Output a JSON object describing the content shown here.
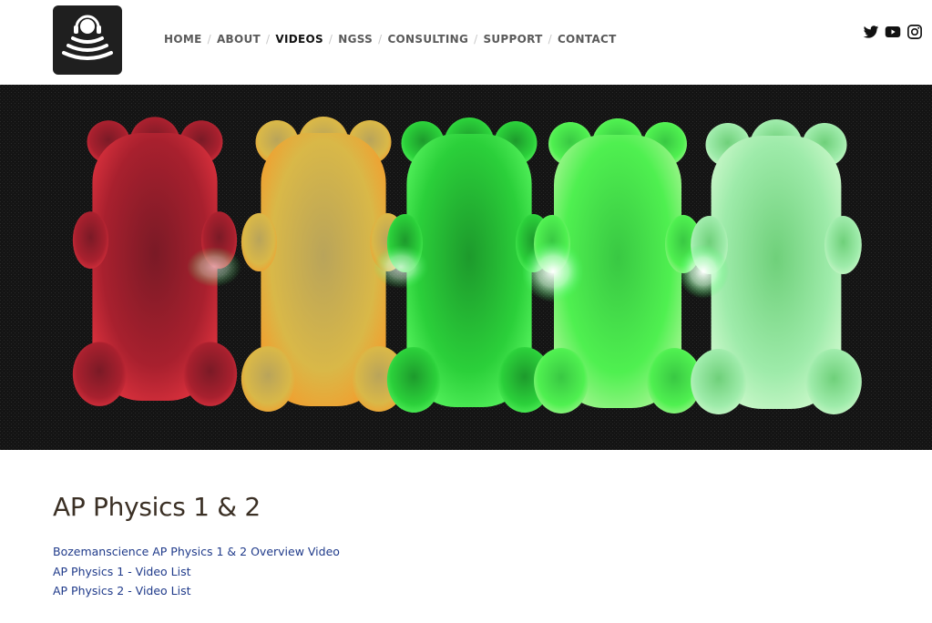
{
  "nav": {
    "items": [
      {
        "label": "HOME",
        "active": false
      },
      {
        "label": "ABOUT",
        "active": false
      },
      {
        "label": "VIDEOS",
        "active": true
      },
      {
        "label": "NGSS",
        "active": false
      },
      {
        "label": "CONSULTING",
        "active": false
      },
      {
        "label": "SUPPORT",
        "active": false
      },
      {
        "label": "CONTACT",
        "active": false
      }
    ],
    "separator": "/"
  },
  "social": [
    "twitter-icon",
    "youtube-icon",
    "instagram-icon"
  ],
  "hero": {
    "image": "gummy-bears-glowing-under-laser",
    "bear_colors": [
      "#c0243a",
      "#e8c24a",
      "#2fdc3a",
      "#48f24a",
      "#9ff2a8"
    ]
  },
  "main": {
    "title": "AP Physics 1 & 2",
    "links": [
      {
        "label": "Bozemanscience AP Physics 1 & 2 Overview Video"
      },
      {
        "label": "AP Physics 1 - Video List"
      },
      {
        "label": "AP Physics 2 - Video List"
      }
    ]
  },
  "colors": {
    "link": "#1f3a8a",
    "title": "#3b3025",
    "nav": "#5a5a5a",
    "nav_active": "#111111"
  }
}
